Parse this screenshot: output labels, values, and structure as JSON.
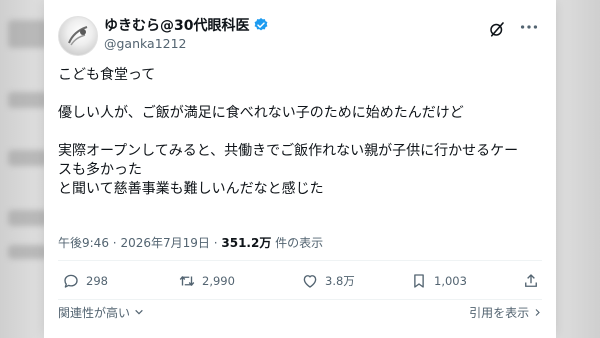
{
  "post": {
    "author": {
      "display_name": "ゆきむら@30代眼科医",
      "handle": "@ganka1212"
    },
    "body": [
      "こども食堂って",
      "",
      "優しい人が、ご飯が満足に食べれない子のために始めたんだけど",
      "",
      "実際オープンしてみると、共働きでご飯作れない親が子供に行かせるケー",
      "スも多かった",
      "と聞いて慈善事業も難しいんだなと感じた"
    ],
    "meta": {
      "time": "午後9:46",
      "separator": "·",
      "date": "2026年7月19日",
      "views_count": "351.2万",
      "views_label": "件の表示"
    },
    "actions": {
      "replies": "298",
      "reposts": "2,990",
      "likes": "3.8万",
      "bookmarks": "1,003"
    },
    "footer": {
      "sort_label": "関連性が高い",
      "quote_link": "引用を表示"
    }
  },
  "icons": {
    "verified": "verified-badge-icon",
    "grok": "grok-icon",
    "more": "more-icon",
    "reply": "reply-icon",
    "repost": "repost-icon",
    "like": "heart-icon",
    "bookmark": "bookmark-icon",
    "share": "share-icon"
  },
  "colors": {
    "verified": "#1d9bf0",
    "text_primary": "#0f1419",
    "text_secondary": "#536471"
  }
}
